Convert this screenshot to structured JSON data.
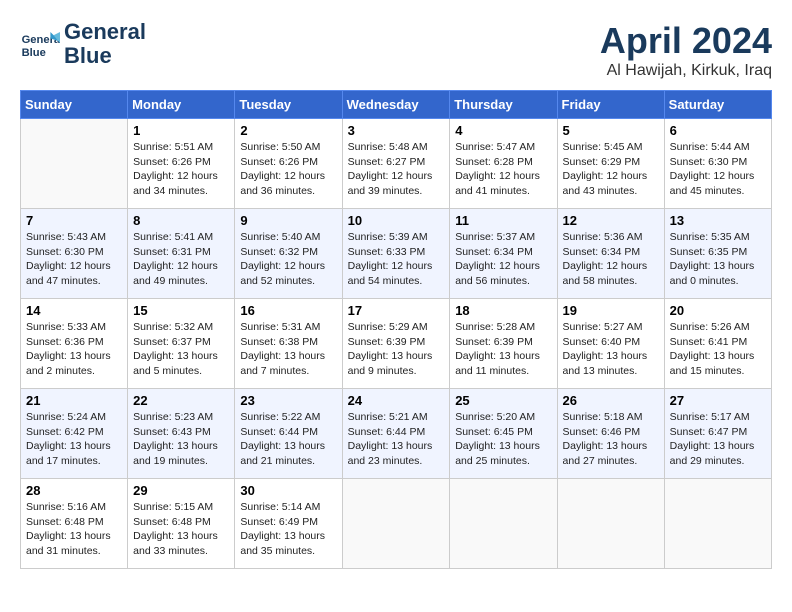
{
  "header": {
    "logo_line1": "General",
    "logo_line2": "Blue",
    "title": "April 2024",
    "location": "Al Hawijah, Kirkuk, Iraq"
  },
  "days_of_week": [
    "Sunday",
    "Monday",
    "Tuesday",
    "Wednesday",
    "Thursday",
    "Friday",
    "Saturday"
  ],
  "weeks": [
    [
      {
        "day": "",
        "info": ""
      },
      {
        "day": "1",
        "info": "Sunrise: 5:51 AM\nSunset: 6:26 PM\nDaylight: 12 hours\nand 34 minutes."
      },
      {
        "day": "2",
        "info": "Sunrise: 5:50 AM\nSunset: 6:26 PM\nDaylight: 12 hours\nand 36 minutes."
      },
      {
        "day": "3",
        "info": "Sunrise: 5:48 AM\nSunset: 6:27 PM\nDaylight: 12 hours\nand 39 minutes."
      },
      {
        "day": "4",
        "info": "Sunrise: 5:47 AM\nSunset: 6:28 PM\nDaylight: 12 hours\nand 41 minutes."
      },
      {
        "day": "5",
        "info": "Sunrise: 5:45 AM\nSunset: 6:29 PM\nDaylight: 12 hours\nand 43 minutes."
      },
      {
        "day": "6",
        "info": "Sunrise: 5:44 AM\nSunset: 6:30 PM\nDaylight: 12 hours\nand 45 minutes."
      }
    ],
    [
      {
        "day": "7",
        "info": "Sunrise: 5:43 AM\nSunset: 6:30 PM\nDaylight: 12 hours\nand 47 minutes."
      },
      {
        "day": "8",
        "info": "Sunrise: 5:41 AM\nSunset: 6:31 PM\nDaylight: 12 hours\nand 49 minutes."
      },
      {
        "day": "9",
        "info": "Sunrise: 5:40 AM\nSunset: 6:32 PM\nDaylight: 12 hours\nand 52 minutes."
      },
      {
        "day": "10",
        "info": "Sunrise: 5:39 AM\nSunset: 6:33 PM\nDaylight: 12 hours\nand 54 minutes."
      },
      {
        "day": "11",
        "info": "Sunrise: 5:37 AM\nSunset: 6:34 PM\nDaylight: 12 hours\nand 56 minutes."
      },
      {
        "day": "12",
        "info": "Sunrise: 5:36 AM\nSunset: 6:34 PM\nDaylight: 12 hours\nand 58 minutes."
      },
      {
        "day": "13",
        "info": "Sunrise: 5:35 AM\nSunset: 6:35 PM\nDaylight: 13 hours\nand 0 minutes."
      }
    ],
    [
      {
        "day": "14",
        "info": "Sunrise: 5:33 AM\nSunset: 6:36 PM\nDaylight: 13 hours\nand 2 minutes."
      },
      {
        "day": "15",
        "info": "Sunrise: 5:32 AM\nSunset: 6:37 PM\nDaylight: 13 hours\nand 5 minutes."
      },
      {
        "day": "16",
        "info": "Sunrise: 5:31 AM\nSunset: 6:38 PM\nDaylight: 13 hours\nand 7 minutes."
      },
      {
        "day": "17",
        "info": "Sunrise: 5:29 AM\nSunset: 6:39 PM\nDaylight: 13 hours\nand 9 minutes."
      },
      {
        "day": "18",
        "info": "Sunrise: 5:28 AM\nSunset: 6:39 PM\nDaylight: 13 hours\nand 11 minutes."
      },
      {
        "day": "19",
        "info": "Sunrise: 5:27 AM\nSunset: 6:40 PM\nDaylight: 13 hours\nand 13 minutes."
      },
      {
        "day": "20",
        "info": "Sunrise: 5:26 AM\nSunset: 6:41 PM\nDaylight: 13 hours\nand 15 minutes."
      }
    ],
    [
      {
        "day": "21",
        "info": "Sunrise: 5:24 AM\nSunset: 6:42 PM\nDaylight: 13 hours\nand 17 minutes."
      },
      {
        "day": "22",
        "info": "Sunrise: 5:23 AM\nSunset: 6:43 PM\nDaylight: 13 hours\nand 19 minutes."
      },
      {
        "day": "23",
        "info": "Sunrise: 5:22 AM\nSunset: 6:44 PM\nDaylight: 13 hours\nand 21 minutes."
      },
      {
        "day": "24",
        "info": "Sunrise: 5:21 AM\nSunset: 6:44 PM\nDaylight: 13 hours\nand 23 minutes."
      },
      {
        "day": "25",
        "info": "Sunrise: 5:20 AM\nSunset: 6:45 PM\nDaylight: 13 hours\nand 25 minutes."
      },
      {
        "day": "26",
        "info": "Sunrise: 5:18 AM\nSunset: 6:46 PM\nDaylight: 13 hours\nand 27 minutes."
      },
      {
        "day": "27",
        "info": "Sunrise: 5:17 AM\nSunset: 6:47 PM\nDaylight: 13 hours\nand 29 minutes."
      }
    ],
    [
      {
        "day": "28",
        "info": "Sunrise: 5:16 AM\nSunset: 6:48 PM\nDaylight: 13 hours\nand 31 minutes."
      },
      {
        "day": "29",
        "info": "Sunrise: 5:15 AM\nSunset: 6:48 PM\nDaylight: 13 hours\nand 33 minutes."
      },
      {
        "day": "30",
        "info": "Sunrise: 5:14 AM\nSunset: 6:49 PM\nDaylight: 13 hours\nand 35 minutes."
      },
      {
        "day": "",
        "info": ""
      },
      {
        "day": "",
        "info": ""
      },
      {
        "day": "",
        "info": ""
      },
      {
        "day": "",
        "info": ""
      }
    ]
  ]
}
